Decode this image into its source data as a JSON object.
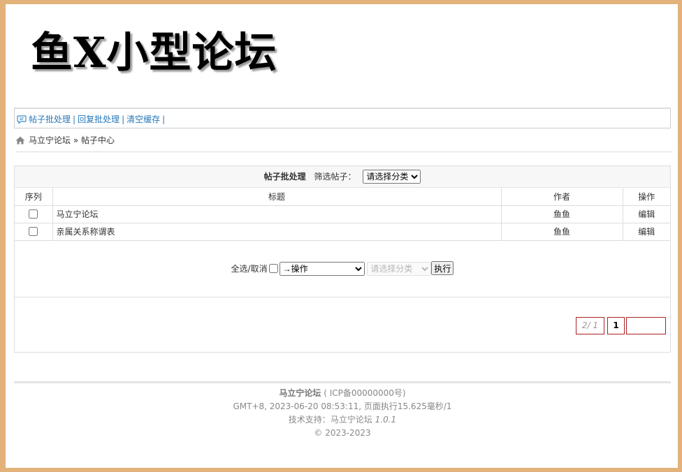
{
  "site": {
    "logo_text": "鱼X小型论坛"
  },
  "topnav": {
    "items": [
      {
        "label": "帖子批处理"
      },
      {
        "label": "回复批处理"
      },
      {
        "label": "清空缓存"
      }
    ],
    "separator": "|"
  },
  "breadcrumb": {
    "home": "马立宁论坛",
    "separator": "»",
    "current": "帖子中心"
  },
  "panel": {
    "title": "帖子批处理",
    "filter_label": "筛选帖子：",
    "filter_selected": "请选择分类"
  },
  "table": {
    "headers": {
      "index": "序列",
      "title": "标题",
      "author": "作者",
      "op": "操作"
    },
    "rows": [
      {
        "title": "马立宁论坛",
        "author": "鱼鱼",
        "op": "编辑"
      },
      {
        "title": "亲属关系称谓表",
        "author": "鱼鱼",
        "op": "编辑"
      }
    ]
  },
  "actions": {
    "select_all_label": "全选/取消",
    "operation_selected": "→操作",
    "category_selected": "请选择分类",
    "execute_label": "执行"
  },
  "pager": {
    "info": "2/ 1",
    "current": "1",
    "jump_value": ""
  },
  "footer": {
    "site_name": "马立宁论坛",
    "icp": "( ICP备00000000号)",
    "time_line": "GMT+8, 2023-06-20 08:53:11, 页面执行15.625毫秒/1",
    "support_label": "技术支持：",
    "support_name": "马立宁论坛",
    "version": "1.0.1",
    "copyright": "© 2023-2023"
  },
  "colors": {
    "link": "#2778b8",
    "pager_border": "#aa2222",
    "page_bg": "#e2b27a"
  },
  "icons": {
    "nav": "chat-bubble-icon",
    "breadcrumb": "home-icon"
  }
}
